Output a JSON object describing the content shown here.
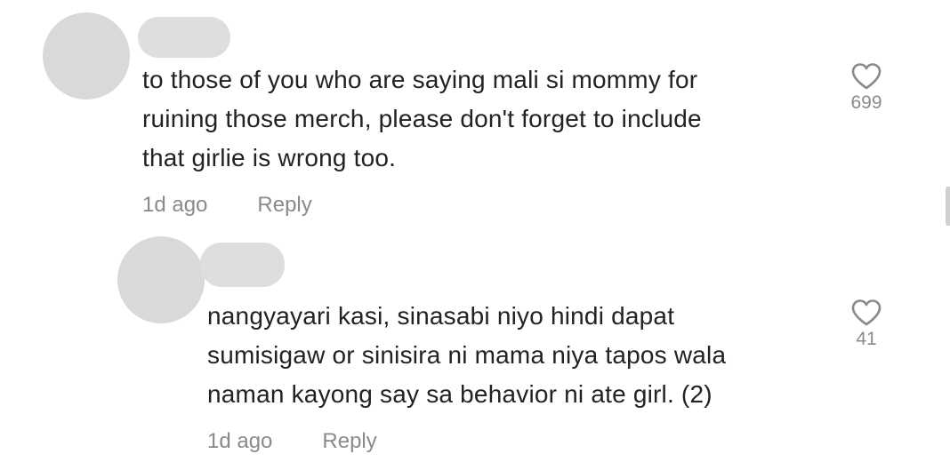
{
  "comments": [
    {
      "lines": [
        "to those of you who are saying mali si mommy for",
        "ruining those merch, please don't forget to include",
        "that girlie is wrong too."
      ],
      "time": "1d ago",
      "reply_label": "Reply",
      "likes": "699",
      "like_icon": "heart-outline-icon"
    },
    {
      "lines": [
        "nangyayari kasi, sinasabi niyo hindi dapat",
        "sumisigaw or sinisira ni mama niya tapos wala",
        "naman kayong say sa behavior ni ate girl. (2)"
      ],
      "time": "1d ago",
      "reply_label": "Reply",
      "likes": "41",
      "like_icon": "heart-outline-icon"
    }
  ],
  "colors": {
    "text": "#222222",
    "meta": "#8a8a8a",
    "placeholder": "#d9d9d9",
    "background": "#ffffff"
  }
}
